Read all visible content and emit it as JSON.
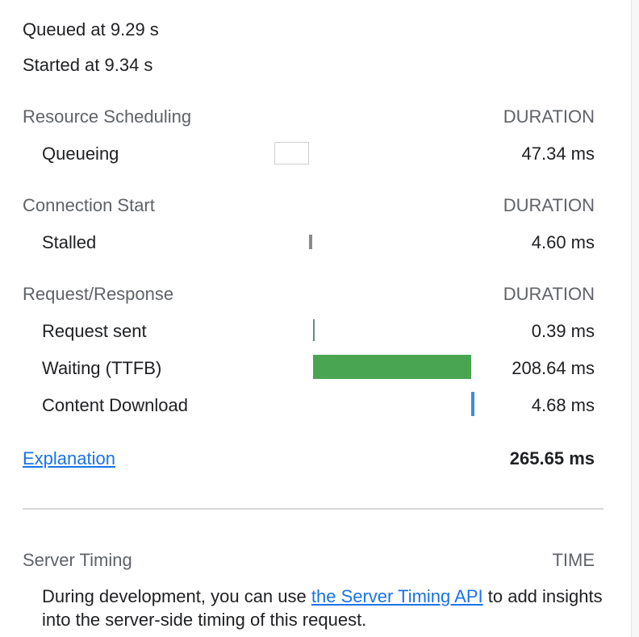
{
  "timing": {
    "queued": "Queued at 9.29 s",
    "started": "Started at 9.34 s"
  },
  "sections": {
    "resource_scheduling": {
      "title": "Resource Scheduling",
      "duration_header": "DURATION",
      "queueing": {
        "label": "Queueing",
        "value": "47.34 ms"
      }
    },
    "connection_start": {
      "title": "Connection Start",
      "duration_header": "DURATION",
      "stalled": {
        "label": "Stalled",
        "value": "4.60 ms"
      }
    },
    "request_response": {
      "title": "Request/Response",
      "duration_header": "DURATION",
      "request_sent": {
        "label": "Request sent",
        "value": "0.39 ms"
      },
      "waiting": {
        "label": "Waiting (TTFB)",
        "value": "208.64 ms"
      },
      "content_download": {
        "label": "Content Download",
        "value": "4.68 ms"
      }
    }
  },
  "footer": {
    "explanation_link": "Explanation",
    "total": "265.65 ms"
  },
  "server_timing": {
    "title": "Server Timing",
    "time_header": "TIME",
    "text_before": "During development, you can use ",
    "link_text": "the Server Timing API",
    "text_after": " to add insights into the server-side timing of this request."
  },
  "colors": {
    "waiting_bar": "#4aa553",
    "download_bar": "#3a8fd6",
    "stalled_bar": "#8a8a8a",
    "request_sent_bar": "#5f8f8a",
    "link": "#1a73e8"
  }
}
